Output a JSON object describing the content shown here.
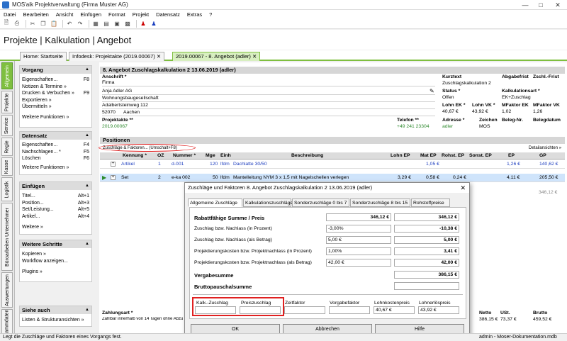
{
  "window": {
    "title": "MOS'aik Projektverwaltung (Firma Muster AG)"
  },
  "menu": [
    "Datei",
    "Bearbeiten",
    "Ansicht",
    "Einfügen",
    "Format",
    "Projekt",
    "Datensatz",
    "Extras",
    "?"
  ],
  "app_title": "Projekte | Kalkulation | Angebot",
  "tabs": [
    "Home: Startseite",
    "Infodesk: Projektakte (2019.00067)",
    "2019.00067 - 8. Angebot (adler)"
  ],
  "vtabs": [
    "Allgemein",
    "Projekte",
    "Service",
    "Regie",
    "Kasse",
    "Logistik",
    "Büroarbeiten Unternehmer",
    "Auswertungen",
    "Stammdaten"
  ],
  "sidebar": {
    "vorgang": {
      "title": "Vorgang",
      "items": [
        {
          "label": "Eigenschaften...",
          "sc": "F8"
        },
        {
          "label": "Notizen & Termine »",
          "sc": ""
        },
        {
          "label": "Drucken & Verbuchen »",
          "sc": "F9"
        },
        {
          "label": "Exportieren »",
          "sc": ""
        },
        {
          "label": "Übermitteln »",
          "sc": ""
        }
      ],
      "more": "Weitere Funktionen »"
    },
    "datensatz": {
      "title": "Datensatz",
      "items": [
        {
          "label": "Eigenschaften...",
          "sc": "F4"
        },
        {
          "label": "Nachschlagen... *",
          "sc": "F5"
        },
        {
          "label": "Löschen",
          "sc": "F6"
        }
      ],
      "more": "Weitere Funktionen »"
    },
    "einfuegen": {
      "title": "Einfügen",
      "items": [
        {
          "label": "Titel...",
          "sc": "Alt+1"
        },
        {
          "label": "Position...",
          "sc": "Alt+3"
        },
        {
          "label": "Set/Leistung...",
          "sc": "Alt+5"
        },
        {
          "label": "Artikel...",
          "sc": "Alt+4"
        }
      ],
      "more": "Weitere »"
    },
    "weitere": {
      "title": "Weitere Schritte",
      "items": [
        {
          "label": "Kopieren »",
          "sc": ""
        },
        {
          "label": "Workflow anzeigen...",
          "sc": ""
        }
      ],
      "more": "Plugins »"
    },
    "suche": {
      "title": "Siehe auch",
      "items": [
        {
          "label": "Listen & Strukturansichten »",
          "sc": ""
        }
      ]
    }
  },
  "header": {
    "title": "8. Angebot Zuschlagskalkulation 2 13.06.2019 (adler)",
    "anschrift_label": "Anschrift *",
    "anschrift": [
      "Firma",
      "Anja Adler AG",
      "Wohnungsbaugesellschaft",
      "Adalbertsteinweg 112"
    ],
    "plz": "52070",
    "ort": "Aachen",
    "kurztext_label": "Kurztext",
    "kurztext": "Zuschlagskalkulation 2",
    "abgabefrist_label": "Abgabefrist",
    "zschl_label": "Zschl.-Frist",
    "status_label": "Status *",
    "status": "Offen",
    "kalkart_label": "Kalkulationsart *",
    "kalkart": "EK+Zuschlag",
    "lohn_ek_label": "Lohn EK *",
    "lohn_ek": "40,67 €",
    "lohn_vk_label": "Lohn VK *",
    "lohn_vk": "43,92 €",
    "mf_ek_label": "MFaktor EK",
    "mf_ek": "1,02",
    "mf_vk_label": "MFaktor VK",
    "mf_vk": "1,26",
    "projektakte_label": "Projektakte **",
    "projektakte": "2019.00067",
    "telefon_label": "Telefon **",
    "telefon": "+49 241 23304",
    "adresse_label": "Adresse *",
    "adresse": "adler",
    "zeichen_label": "Zeichen",
    "zeichen": "MOS",
    "belegnr_label": "Beleg-Nr.",
    "belegdatum_label": "Belegdatum"
  },
  "positions": {
    "title": "Positionen",
    "zuschlag_link": "Zuschläge & Faktoren... (Umschalt+F8)",
    "detail_link": "Detailansichten »",
    "columns": [
      "Kennung *",
      "OZ",
      "Nummer *",
      "Mge",
      "Einh",
      "Beschreibung",
      "Lohn EP",
      "Mat EP",
      "Rohst. EP",
      "Sonst. EP",
      "EP",
      "GP"
    ],
    "rows": [
      {
        "kennung": "Artikel",
        "oz": "1",
        "nummer": "d-001",
        "mge": "120",
        "einh": "lfdm",
        "beschr": "Dachlatte 30/50",
        "lohn": "",
        "mat": "1,05 €",
        "rohst": "",
        "sonst": "",
        "ep": "1,26 €",
        "gp": "140,62 €"
      },
      {
        "kennung": "Set",
        "oz": "2",
        "nummer": "e-ka 002",
        "mge": "50",
        "einh": "lfdm",
        "beschr": "Mantelleitung NYM 3 x 1,5 mit Nagelschellen verlegen",
        "lohn": "3,29 €",
        "mat": "0,58 €",
        "rohst": "0,24 €",
        "sonst": "",
        "ep": "4,11 €",
        "gp": "205,50 €"
      }
    ],
    "total": "346,12 €",
    "zahlungsart_label": "Zahlungsart *",
    "zahlungsart": "Zahlbar innerhalb von 14 Tagen ohne Abzug",
    "netto_label": "Netto",
    "netto": "386,15 €",
    "ust_label": "USt.",
    "ust": "73,37 €",
    "brutto_label": "Brutto",
    "brutto": "459,52 €"
  },
  "dialog": {
    "title": "Zuschläge und Faktoren 8. Angebot Zuschlagskalkulation 2 13.06.2019 (adler)",
    "tabs": [
      "Allgemeine Zuschläge",
      "Kalkulationszuschläge",
      "Sonderzuschläge 0 bis 7",
      "Sonderzuschläge 8 bis 15",
      "Rohstoffpreise"
    ],
    "rabatt_label": "Rabattfähige Summe / Preis",
    "rabatt_a": "346,12 €",
    "rabatt_b": "346,12 €",
    "rows": [
      {
        "label": "Zuschlag bzw. Nachlass (in Prozent)",
        "input": "-3,00%",
        "result": "-10,38 €"
      },
      {
        "label": "Zuschlag bzw. Nachlass (als Betrag)",
        "input": "5,00 €",
        "result": "5,00 €"
      },
      {
        "label": "Projektierungskosten bzw. Projektnachlass (in Prozent)",
        "input": "1,00%",
        "result": "3,41 €"
      },
      {
        "label": "Projektierungskosten bzw. Projektnachlass (als Betrag)",
        "input": "42,00 €",
        "result": "42,00 €"
      }
    ],
    "vergabe_label": "Vergabesumme",
    "vergabe": "386,15 €",
    "brutto_label": "Bruttopauschalsumme",
    "bottom": [
      {
        "label": "Kalk.-Zuschlag",
        "value": ""
      },
      {
        "label": "Preiszuschlag",
        "value": ""
      },
      {
        "label": "Zeitfaktor",
        "value": ""
      },
      {
        "label": "Vorgabefaktor",
        "value": ""
      },
      {
        "label": "Lohnkostenpreis",
        "value": "40,67 €"
      },
      {
        "label": "Lohnerlöspreis",
        "value": "43,92 €"
      }
    ],
    "ok": "OK",
    "abbrechen": "Abbrechen",
    "hilfe": "Hilfe"
  },
  "statusbar": {
    "left": "Legt die Zuschläge und Faktoren eines Vorgangs fest.",
    "right": "admin - Moser-Dokumentation.mdb"
  }
}
